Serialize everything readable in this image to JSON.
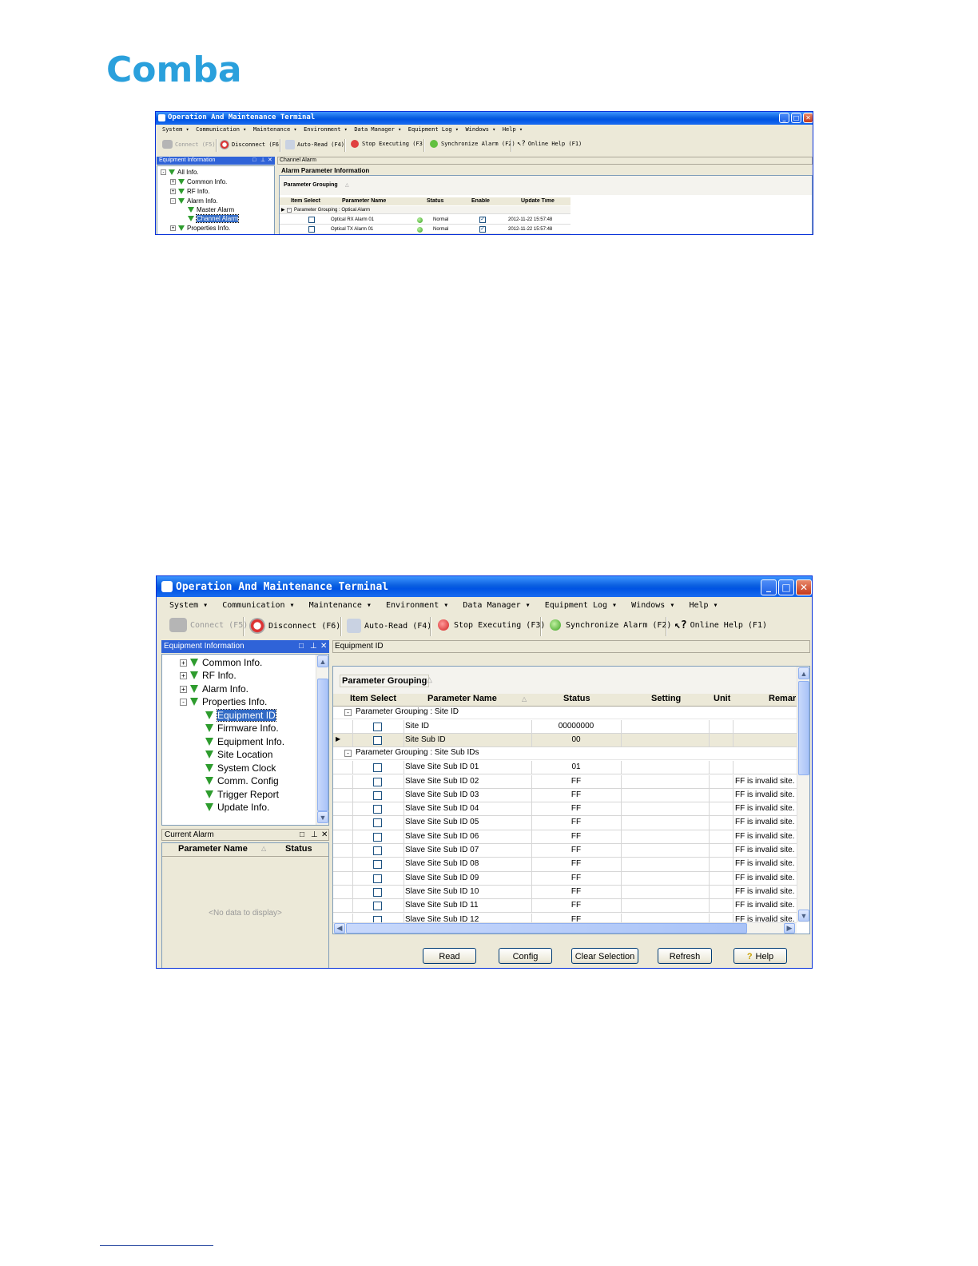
{
  "logo": {
    "text": "Comba",
    "color": "#2aa0dc"
  },
  "window": {
    "title": "Operation And Maintenance Terminal",
    "menu": [
      "System",
      "Communication",
      "Maintenance",
      "Environment",
      "Data Manager",
      "Equipment Log",
      "Windows",
      "Help"
    ],
    "toolbar": {
      "connect": "Connect (F5)",
      "disconnect": "Disconnect (F6)",
      "auto_read": "Auto-Read (F4)",
      "stop": "Stop Executing (F3)",
      "sync": "Synchronize Alarm (F2)",
      "help": "Online Help (F1)"
    },
    "equipment_panel_title": "Equipment Information"
  },
  "screenshot1": {
    "tree": {
      "all": "All Info.",
      "common": "Common Info.",
      "rf": "RF Info.",
      "alarm": "Alarm Info.",
      "master": "Master Alarm",
      "channel": "Channel Alarm",
      "properties": "Properties Info."
    },
    "tab": "Channel Alarm",
    "section_title": "Alarm Parameter Information",
    "grouping_label": "Parameter Grouping",
    "columns": {
      "item_select": "Item Select",
      "param_name": "Parameter Name",
      "status": "Status",
      "enable": "Enable",
      "update_time": "Update Time"
    },
    "group_row": "Parameter Grouping : Optical Alarm",
    "rows": [
      {
        "name": "Optical RX Alarm 01",
        "status": "Normal",
        "time": "2012-11-22 15:57:48"
      },
      {
        "name": "Optical TX Alarm 01",
        "status": "Normal",
        "time": "2012-11-22 15:57:48"
      }
    ]
  },
  "screenshot2": {
    "tree": {
      "common": "Common Info.",
      "rf": "RF Info.",
      "alarm": "Alarm Info.",
      "properties": "Properties Info.",
      "children": [
        "Equipment ID",
        "Firmware Info.",
        "Equipment Info.",
        "Site Location",
        "System Clock",
        "Comm. Config",
        "Trigger Report",
        "Update Info."
      ]
    },
    "current_alarm": {
      "title": "Current Alarm",
      "col_name": "Parameter Name",
      "col_status": "Status",
      "empty": "<No data to display>"
    },
    "tab": "Equipment ID",
    "grouping_label": "Parameter Grouping",
    "columns": {
      "item_select": "Item Select",
      "param_name": "Parameter Name",
      "status": "Status",
      "setting": "Setting",
      "unit": "Unit",
      "remark": "Remar"
    },
    "group1": "Parameter Grouping : Site ID",
    "group1_rows": [
      {
        "name": "Site ID",
        "status": "00000000",
        "remark": ""
      },
      {
        "name": "Site Sub ID",
        "status": "00",
        "remark": ""
      }
    ],
    "group2": "Parameter Grouping : Site Sub IDs",
    "group2_rows": [
      {
        "name": "Slave Site Sub ID 01",
        "status": "01",
        "remark": ""
      },
      {
        "name": "Slave Site Sub ID 02",
        "status": "FF",
        "remark": "FF is invalid site."
      },
      {
        "name": "Slave Site Sub ID 03",
        "status": "FF",
        "remark": "FF is invalid site."
      },
      {
        "name": "Slave Site Sub ID 04",
        "status": "FF",
        "remark": "FF is invalid site."
      },
      {
        "name": "Slave Site Sub ID 05",
        "status": "FF",
        "remark": "FF is invalid site."
      },
      {
        "name": "Slave Site Sub ID 06",
        "status": "FF",
        "remark": "FF is invalid site."
      },
      {
        "name": "Slave Site Sub ID 07",
        "status": "FF",
        "remark": "FF is invalid site."
      },
      {
        "name": "Slave Site Sub ID 08",
        "status": "FF",
        "remark": "FF is invalid site."
      },
      {
        "name": "Slave Site Sub ID 09",
        "status": "FF",
        "remark": "FF is invalid site."
      },
      {
        "name": "Slave Site Sub ID 10",
        "status": "FF",
        "remark": "FF is invalid site."
      },
      {
        "name": "Slave Site Sub ID 11",
        "status": "FF",
        "remark": "FF is invalid site."
      },
      {
        "name": "Slave Site Sub ID 12",
        "status": "FF",
        "remark": "FF is invalid site."
      }
    ],
    "buttons": {
      "read": "Read",
      "config": "Config",
      "clear": "Clear Selection",
      "refresh": "Refresh",
      "help": "Help"
    }
  }
}
